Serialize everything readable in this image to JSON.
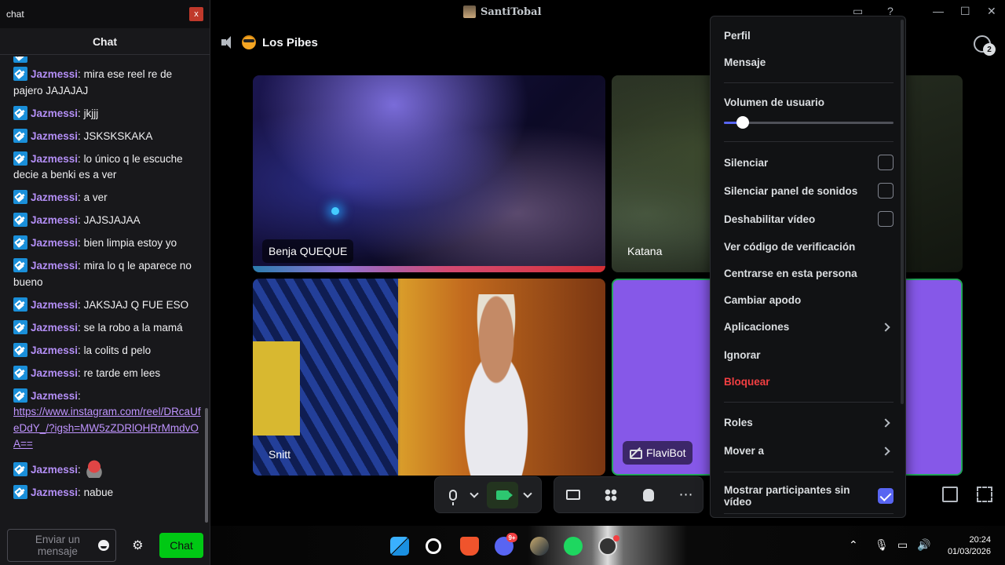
{
  "chat_window": {
    "title": "chat",
    "close_label": "x",
    "header": "Chat",
    "messages": [
      {
        "user": "Jazmessi",
        "text": "mira ese reel re de pajero JAJAJAJ"
      },
      {
        "user": "Jazmessi",
        "text": "jkjjj"
      },
      {
        "user": "Jazmessi",
        "text": "JSKSKSKAKA"
      },
      {
        "user": "Jazmessi",
        "text": "lo único q le escuche decie a benki es a ver"
      },
      {
        "user": "Jazmessi",
        "text": "a ver"
      },
      {
        "user": "Jazmessi",
        "text": "JAJSJAJAA"
      },
      {
        "user": "Jazmessi",
        "text": "bien limpia estoy yo"
      },
      {
        "user": "Jazmessi",
        "text": "mira lo q le aparece no bueno"
      },
      {
        "user": "Jazmessi",
        "text": "JAKSJAJ Q FUE ESO"
      },
      {
        "user": "Jazmessi",
        "text": "se la robo a la mamá"
      },
      {
        "user": "Jazmessi",
        "text": "la colits d pelo"
      },
      {
        "user": "Jazmessi",
        "text": "re tarde em lees"
      },
      {
        "user": "Jazmessi",
        "link": "https://www.instagram.com/reel/DRcaUfeDdY_/?igsh=MW5zZDRlOHRrMmdvOA=="
      },
      {
        "user": "Jazmessi",
        "emote": "emote-icon"
      },
      {
        "user": "Jazmessi",
        "text": "nabue"
      }
    ],
    "input_placeholder": "Enviar un mensaje",
    "send_label": "Chat"
  },
  "discord": {
    "window_title": "SantiTobal",
    "channel_name": "Los Pibes",
    "threads_count": "2",
    "tiles": [
      {
        "name": "Benja QUEQUE"
      },
      {
        "name": "Katana"
      },
      {
        "name": "Snitt"
      },
      {
        "name": "FlaviBot"
      }
    ],
    "context_menu": {
      "profile": "Perfil",
      "message": "Mensaje",
      "volume_label": "Volumen de usuario",
      "volume_level": 0.11,
      "mute": "Silenciar",
      "mute_soundboard": "Silenciar panel de sonidos",
      "disable_video": "Deshabilitar vídeo",
      "verify_code": "Ver código de verificación",
      "focus": "Centrarse en esta persona",
      "nickname": "Cambiar apodo",
      "apps": "Aplicaciones",
      "ignore": "Ignorar",
      "block": "Bloquear",
      "roles": "Roles",
      "move_to": "Mover a",
      "show_no_video": "Mostrar participantes sin vídeo"
    }
  },
  "taskbar": {
    "discord_badge": "9+",
    "time": "20:24",
    "date": "01/03/2026"
  }
}
